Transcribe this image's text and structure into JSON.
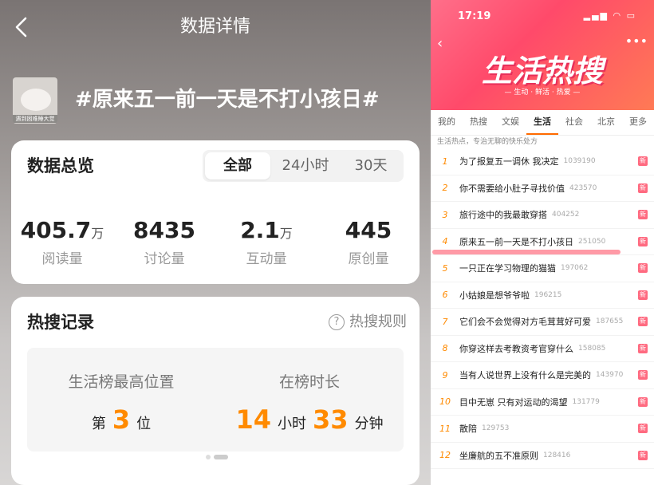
{
  "left": {
    "title": "数据详情",
    "thumbnail_caption": "遇到困难睡大觉",
    "topic": "#原来五一前一天是不打小孩日#",
    "overview": {
      "title": "数据总览",
      "segments": [
        "全部",
        "24小时",
        "30天"
      ],
      "selected_segment": "全部",
      "stats": [
        {
          "value": "405.7",
          "unit": "万",
          "label": "阅读量"
        },
        {
          "value": "8435",
          "unit": "",
          "label": "讨论量"
        },
        {
          "value": "2.1",
          "unit": "万",
          "label": "互动量"
        },
        {
          "value": "445",
          "unit": "",
          "label": "原创量"
        }
      ]
    },
    "hot": {
      "title": "热搜记录",
      "rules_label": "热搜规则",
      "rules_icon": "question-circle-icon",
      "peak_label": "生活榜最高位置",
      "peak_prefix": "第",
      "peak_value": "3",
      "peak_suffix": "位",
      "duration_label": "在榜时长",
      "hours": "14",
      "hours_unit": "小时",
      "minutes": "33",
      "minutes_unit": "分钟"
    }
  },
  "right": {
    "status_time": "17:19",
    "banner_title": "生活热搜",
    "banner_sub": "— 生动 · 鲜活 · 热爱 —",
    "tabs": [
      "我的",
      "热搜",
      "文娱",
      "生活",
      "社会",
      "北京",
      "更多"
    ],
    "selected_tab": "生活",
    "tagline": "生活热点，专治无聊的快乐处方",
    "items": [
      {
        "rank": "1",
        "title": "为了报复五一调休 我决定",
        "count": "1039190",
        "badge": "新"
      },
      {
        "rank": "2",
        "title": "你不需要给小肚子寻找价值",
        "count": "423570",
        "badge": "新"
      },
      {
        "rank": "3",
        "title": "旅行途中的我最敢穿搭",
        "count": "404252",
        "badge": "新"
      },
      {
        "rank": "4",
        "title": "原来五一前一天是不打小孩日",
        "count": "251050",
        "badge": "新"
      },
      {
        "rank": "5",
        "title": "一只正在学习物理的猫猫",
        "count": "197062",
        "badge": "新"
      },
      {
        "rank": "6",
        "title": "小姑娘是想爷爷啦",
        "count": "196215",
        "badge": "新"
      },
      {
        "rank": "7",
        "title": "它们会不会觉得对方毛茸茸好可爱",
        "count": "187655",
        "badge": "新"
      },
      {
        "rank": "8",
        "title": "你穿这样去考教资考官穿什么",
        "count": "158085",
        "badge": "新"
      },
      {
        "rank": "9",
        "title": "当有人说世界上没有什么是完美的",
        "count": "143970",
        "badge": "新"
      },
      {
        "rank": "10",
        "title": "目中无崽 只有对运动的渴望",
        "count": "131779",
        "badge": "新"
      },
      {
        "rank": "11",
        "title": "散陪",
        "count": "129753",
        "badge": "新"
      },
      {
        "rank": "12",
        "title": "坐廉航的五不准原则",
        "count": "128416",
        "badge": "新"
      }
    ]
  }
}
